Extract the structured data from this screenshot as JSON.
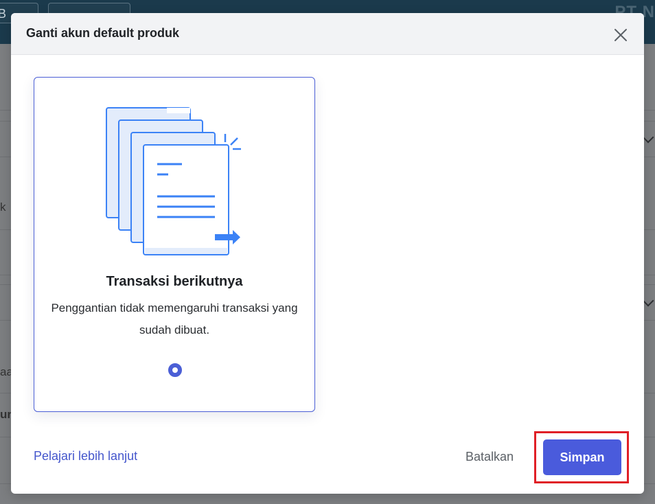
{
  "background": {
    "top_button_1": "B",
    "top_corner_text": "PT N",
    "edge_texts": [
      "k",
      "aa",
      "ur"
    ]
  },
  "modal": {
    "title": "Ganti akun default produk",
    "close_icon": "close-icon",
    "option": {
      "title": "Transaksi berikutnya",
      "description": "Penggantian tidak memengaruhi transaksi yang sudah dibuat.",
      "selected": true,
      "illustration_icon": "documents-forward-icon"
    },
    "learn_more_label": "Pelajari lebih lanjut",
    "cancel_label": "Batalkan",
    "save_label": "Simpan"
  },
  "colors": {
    "accent": "#4a5bdc",
    "link": "#4456cc",
    "highlight": "#e01f26",
    "illustration_blue": "#3b82f6"
  }
}
